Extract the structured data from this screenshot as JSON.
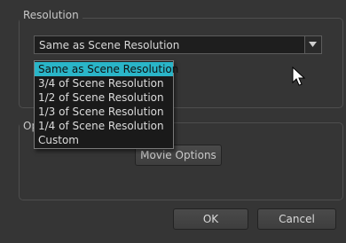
{
  "resolution_group": {
    "title": "Resolution",
    "combo_value": "Same as Scene Resolution",
    "options": [
      "Same as Scene Resolution",
      "3/4 of Scene Resolution",
      "1/2 of Scene Resolution",
      "1/3 of Scene Resolution",
      "1/4 of Scene Resolution",
      "Custom"
    ],
    "highlighted_index": 0
  },
  "options_group": {
    "title": "Op",
    "movie_options_label": "Movie Options"
  },
  "buttons": {
    "ok": "OK",
    "cancel": "Cancel"
  },
  "colors": {
    "highlight": "#2ab5c8",
    "background": "#353535"
  },
  "icons": {
    "combo_arrow": "chevron-down-icon",
    "cursor": "mouse-pointer-icon"
  }
}
